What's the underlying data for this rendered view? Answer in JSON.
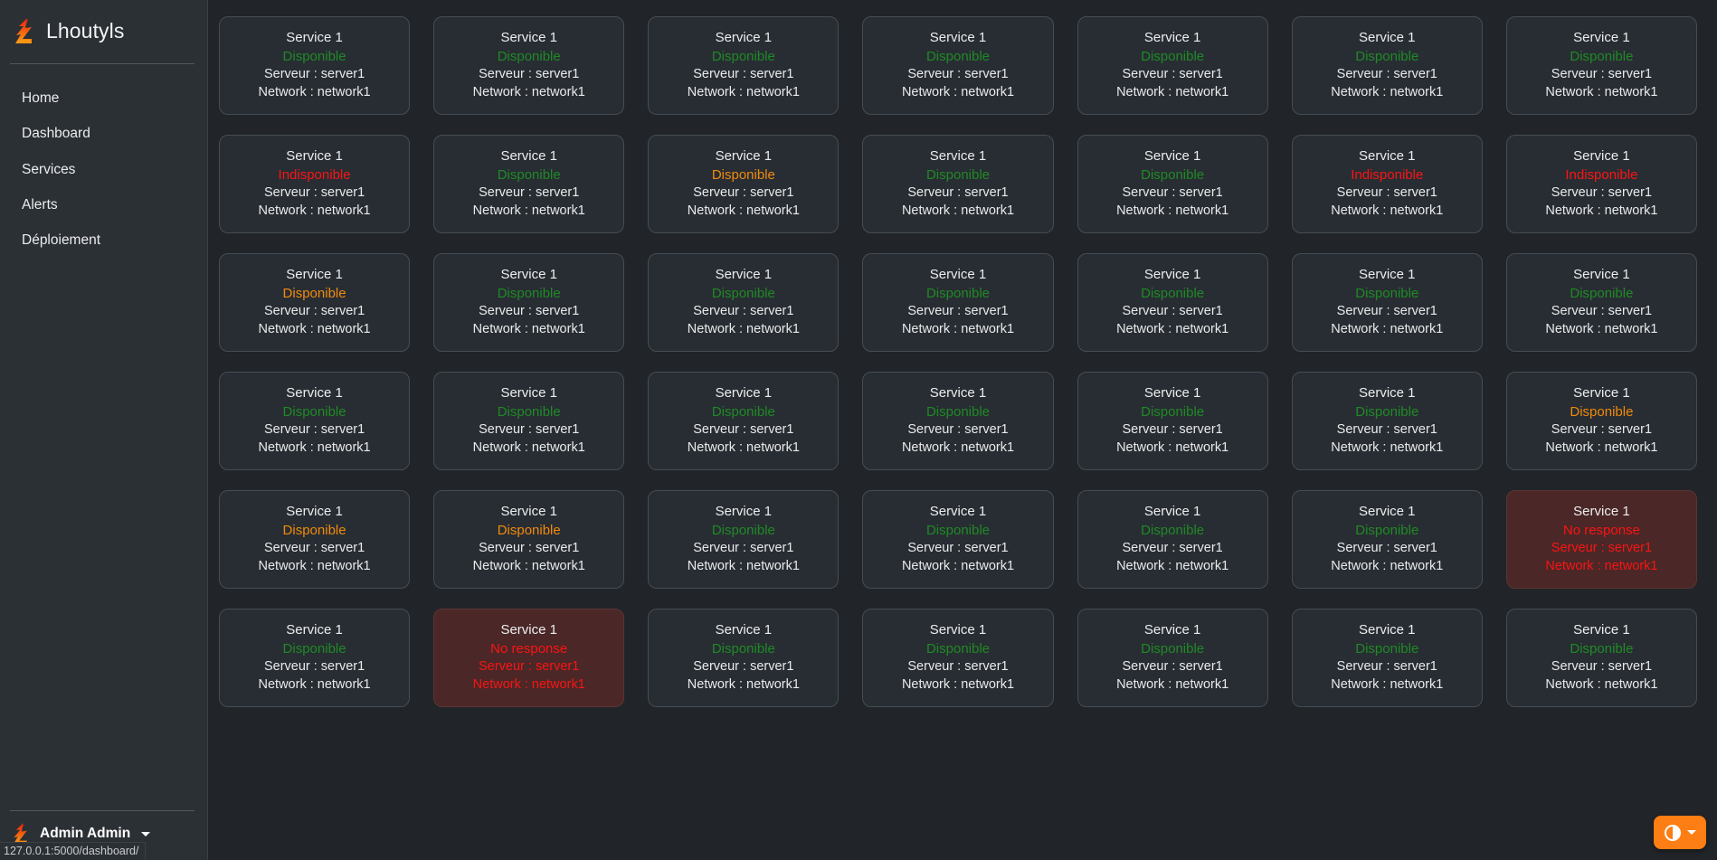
{
  "sidebar": {
    "brand": {
      "name": "Lhoutyls",
      "logo_icon": "lightning-l-logo"
    },
    "items": [
      {
        "label": "Home"
      },
      {
        "label": "Dashboard"
      },
      {
        "label": "Services"
      },
      {
        "label": "Alerts"
      },
      {
        "label": "Déploiement"
      }
    ],
    "user": {
      "name": "Admin Admin",
      "avatar_icon": "lightning-l-logo",
      "caret_icon": "caret-down-icon"
    }
  },
  "statusbar": {
    "url": "127.0.0.1:5000/dashboard/"
  },
  "theme_fab": {
    "icon": "contrast-circle-icon",
    "caret_icon": "caret-down-icon"
  },
  "labels": {
    "service_title": "Service 1",
    "server_line": "Serveur : server1",
    "network_line": "Network : network1"
  },
  "status_text": {
    "available": "Disponible",
    "unavailable": "Indisponible",
    "no_response": "No response"
  },
  "colors": {
    "available_green": "#1f8a25",
    "available_orange": "#f08a0c",
    "unavailable_red": "#fa1414",
    "alert_bg": "#4b2727",
    "accent_orange": "#fd7e14",
    "sidebar_bg": "#2b3035",
    "main_bg": "#212529",
    "card_bg": "#282d33"
  },
  "grid": {
    "columns": 7,
    "rows": 6,
    "cards": [
      {
        "title": "Service 1",
        "status": "Disponible",
        "state": "green",
        "server": "Serveur : server1",
        "network": "Network : network1"
      },
      {
        "title": "Service 1",
        "status": "Disponible",
        "state": "green",
        "server": "Serveur : server1",
        "network": "Network : network1"
      },
      {
        "title": "Service 1",
        "status": "Disponible",
        "state": "green",
        "server": "Serveur : server1",
        "network": "Network : network1"
      },
      {
        "title": "Service 1",
        "status": "Disponible",
        "state": "green",
        "server": "Serveur : server1",
        "network": "Network : network1"
      },
      {
        "title": "Service 1",
        "status": "Disponible",
        "state": "green",
        "server": "Serveur : server1",
        "network": "Network : network1"
      },
      {
        "title": "Service 1",
        "status": "Disponible",
        "state": "green",
        "server": "Serveur : server1",
        "network": "Network : network1"
      },
      {
        "title": "Service 1",
        "status": "Disponible",
        "state": "green",
        "server": "Serveur : server1",
        "network": "Network : network1"
      },
      {
        "title": "Service 1",
        "status": "Indisponible",
        "state": "red",
        "server": "Serveur : server1",
        "network": "Network : network1"
      },
      {
        "title": "Service 1",
        "status": "Disponible",
        "state": "green",
        "server": "Serveur : server1",
        "network": "Network : network1"
      },
      {
        "title": "Service 1",
        "status": "Disponible",
        "state": "orange",
        "server": "Serveur : server1",
        "network": "Network : network1"
      },
      {
        "title": "Service 1",
        "status": "Disponible",
        "state": "green",
        "server": "Serveur : server1",
        "network": "Network : network1"
      },
      {
        "title": "Service 1",
        "status": "Disponible",
        "state": "green",
        "server": "Serveur : server1",
        "network": "Network : network1"
      },
      {
        "title": "Service 1",
        "status": "Indisponible",
        "state": "red",
        "server": "Serveur : server1",
        "network": "Network : network1"
      },
      {
        "title": "Service 1",
        "status": "Indisponible",
        "state": "red",
        "server": "Serveur : server1",
        "network": "Network : network1"
      },
      {
        "title": "Service 1",
        "status": "Disponible",
        "state": "orange",
        "server": "Serveur : server1",
        "network": "Network : network1"
      },
      {
        "title": "Service 1",
        "status": "Disponible",
        "state": "green",
        "server": "Serveur : server1",
        "network": "Network : network1"
      },
      {
        "title": "Service 1",
        "status": "Disponible",
        "state": "green",
        "server": "Serveur : server1",
        "network": "Network : network1"
      },
      {
        "title": "Service 1",
        "status": "Disponible",
        "state": "green",
        "server": "Serveur : server1",
        "network": "Network : network1"
      },
      {
        "title": "Service 1",
        "status": "Disponible",
        "state": "green",
        "server": "Serveur : server1",
        "network": "Network : network1"
      },
      {
        "title": "Service 1",
        "status": "Disponible",
        "state": "green",
        "server": "Serveur : server1",
        "network": "Network : network1"
      },
      {
        "title": "Service 1",
        "status": "Disponible",
        "state": "green",
        "server": "Serveur : server1",
        "network": "Network : network1"
      },
      {
        "title": "Service 1",
        "status": "Disponible",
        "state": "green",
        "server": "Serveur : server1",
        "network": "Network : network1"
      },
      {
        "title": "Service 1",
        "status": "Disponible",
        "state": "green",
        "server": "Serveur : server1",
        "network": "Network : network1"
      },
      {
        "title": "Service 1",
        "status": "Disponible",
        "state": "green",
        "server": "Serveur : server1",
        "network": "Network : network1"
      },
      {
        "title": "Service 1",
        "status": "Disponible",
        "state": "green",
        "server": "Serveur : server1",
        "network": "Network : network1"
      },
      {
        "title": "Service 1",
        "status": "Disponible",
        "state": "green",
        "server": "Serveur : server1",
        "network": "Network : network1"
      },
      {
        "title": "Service 1",
        "status": "Disponible",
        "state": "green",
        "server": "Serveur : server1",
        "network": "Network : network1"
      },
      {
        "title": "Service 1",
        "status": "Disponible",
        "state": "orange",
        "server": "Serveur : server1",
        "network": "Network : network1"
      },
      {
        "title": "Service 1",
        "status": "Disponible",
        "state": "orange",
        "server": "Serveur : server1",
        "network": "Network : network1"
      },
      {
        "title": "Service 1",
        "status": "Disponible",
        "state": "orange",
        "server": "Serveur : server1",
        "network": "Network : network1"
      },
      {
        "title": "Service 1",
        "status": "Disponible",
        "state": "green",
        "server": "Serveur : server1",
        "network": "Network : network1"
      },
      {
        "title": "Service 1",
        "status": "Disponible",
        "state": "green",
        "server": "Serveur : server1",
        "network": "Network : network1"
      },
      {
        "title": "Service 1",
        "status": "Disponible",
        "state": "green",
        "server": "Serveur : server1",
        "network": "Network : network1"
      },
      {
        "title": "Service 1",
        "status": "Disponible",
        "state": "green",
        "server": "Serveur : server1",
        "network": "Network : network1"
      },
      {
        "title": "Service 1",
        "status": "No response",
        "state": "alert",
        "server": "Serveur : server1",
        "network": "Network : network1"
      },
      {
        "title": "Service 1",
        "status": "Disponible",
        "state": "green",
        "server": "Serveur : server1",
        "network": "Network : network1"
      },
      {
        "title": "Service 1",
        "status": "No response",
        "state": "alert",
        "server": "Serveur : server1",
        "network": "Network : network1"
      },
      {
        "title": "Service 1",
        "status": "Disponible",
        "state": "green",
        "server": "Serveur : server1",
        "network": "Network : network1"
      },
      {
        "title": "Service 1",
        "status": "Disponible",
        "state": "green",
        "server": "Serveur : server1",
        "network": "Network : network1"
      },
      {
        "title": "Service 1",
        "status": "Disponible",
        "state": "green",
        "server": "Serveur : server1",
        "network": "Network : network1"
      },
      {
        "title": "Service 1",
        "status": "Disponible",
        "state": "green",
        "server": "Serveur : server1",
        "network": "Network : network1"
      },
      {
        "title": "Service 1",
        "status": "Disponible",
        "state": "green",
        "server": "Serveur : server1",
        "network": "Network : network1"
      }
    ]
  }
}
